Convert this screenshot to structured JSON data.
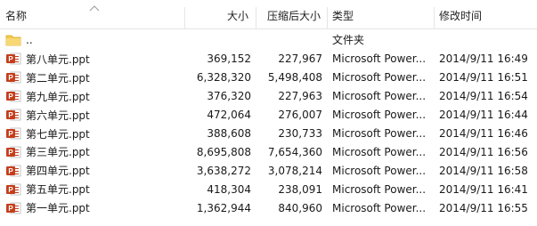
{
  "columns": {
    "name": "名称",
    "size": "大小",
    "compressed": "压缩后大小",
    "type": "类型",
    "modified": "修改时间"
  },
  "rows": [
    {
      "name": "..",
      "size": "",
      "compressed": "",
      "type": "文件夹",
      "modified": "",
      "icon": "folder-icon"
    },
    {
      "name": "第八单元.ppt",
      "size": "369,152",
      "compressed": "227,967",
      "type": "Microsoft Power...",
      "modified": "2014/9/11 16:49",
      "icon": "powerpoint-icon"
    },
    {
      "name": "第二单元.ppt",
      "size": "6,328,320",
      "compressed": "5,498,408",
      "type": "Microsoft Power...",
      "modified": "2014/9/11 16:51",
      "icon": "powerpoint-icon"
    },
    {
      "name": "第九单元.ppt",
      "size": "376,320",
      "compressed": "227,963",
      "type": "Microsoft Power...",
      "modified": "2014/9/11 16:54",
      "icon": "powerpoint-icon"
    },
    {
      "name": "第六单元.ppt",
      "size": "472,064",
      "compressed": "276,007",
      "type": "Microsoft Power...",
      "modified": "2014/9/11 16:44",
      "icon": "powerpoint-icon"
    },
    {
      "name": "第七单元.ppt",
      "size": "388,608",
      "compressed": "230,733",
      "type": "Microsoft Power...",
      "modified": "2014/9/11 16:46",
      "icon": "powerpoint-icon"
    },
    {
      "name": "第三单元.ppt",
      "size": "8,695,808",
      "compressed": "7,654,360",
      "type": "Microsoft Power...",
      "modified": "2014/9/11 16:56",
      "icon": "powerpoint-icon"
    },
    {
      "name": "第四单元.ppt",
      "size": "3,638,272",
      "compressed": "3,078,214",
      "type": "Microsoft Power...",
      "modified": "2014/9/11 16:58",
      "icon": "powerpoint-icon"
    },
    {
      "name": "第五单元.ppt",
      "size": "418,304",
      "compressed": "238,091",
      "type": "Microsoft Power...",
      "modified": "2014/9/11 16:41",
      "icon": "powerpoint-icon"
    },
    {
      "name": "第一单元.ppt",
      "size": "1,362,944",
      "compressed": "840,960",
      "type": "Microsoft Power...",
      "modified": "2014/9/11 16:55",
      "icon": "powerpoint-icon"
    }
  ],
  "colors": {
    "header_separator": "#e5e5e5",
    "folder": "#f2c94c",
    "powerpoint": "#c43e1c"
  }
}
